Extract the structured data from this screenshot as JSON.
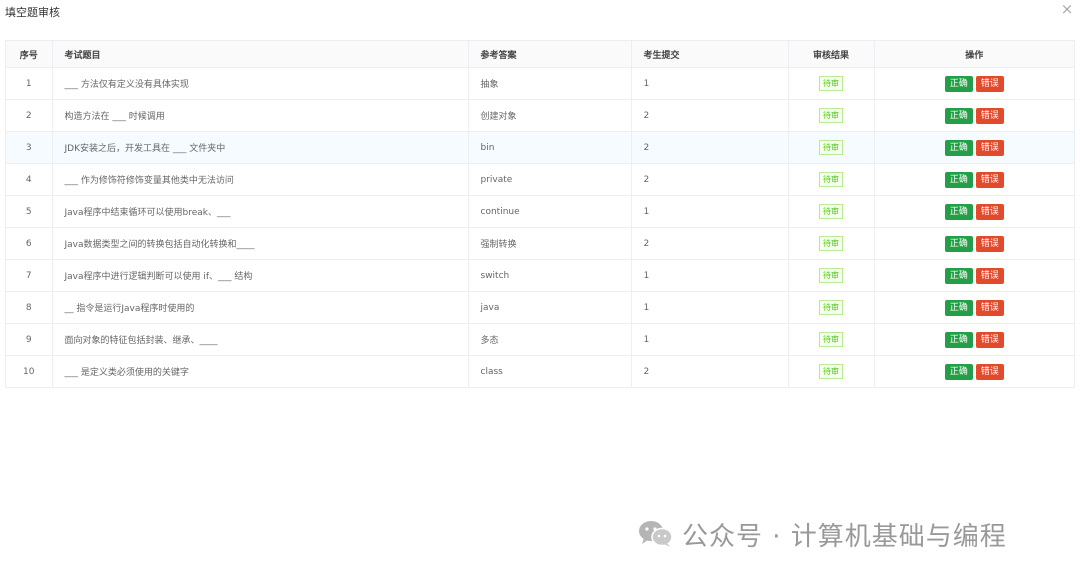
{
  "dialog": {
    "title": "填空题审核",
    "close_icon": "close-icon"
  },
  "table": {
    "headers": {
      "index": "序号",
      "question": "考试题目",
      "reference": "参考答案",
      "submission": "考生提交",
      "result": "审核结果",
      "action": "操作"
    },
    "rows": [
      {
        "index": "1",
        "question": "___ 方法仅有定义没有具体实现",
        "reference": "抽象",
        "submission": "1",
        "status": "待审",
        "correct": "正确",
        "wrong": "错误"
      },
      {
        "index": "2",
        "question": "构造方法在 ___ 时候调用",
        "reference": "创建对象",
        "submission": "2",
        "status": "待审",
        "correct": "正确",
        "wrong": "错误"
      },
      {
        "index": "3",
        "question": "JDK安装之后，开发工具在 ___ 文件夹中",
        "reference": "bin",
        "submission": "2",
        "status": "待审",
        "correct": "正确",
        "wrong": "错误"
      },
      {
        "index": "4",
        "question": "___ 作为修饰符修饰变量其他类中无法访问",
        "reference": "private",
        "submission": "2",
        "status": "待审",
        "correct": "正确",
        "wrong": "错误"
      },
      {
        "index": "5",
        "question": "Java程序中结束循环可以使用break、___",
        "reference": "continue",
        "submission": "1",
        "status": "待审",
        "correct": "正确",
        "wrong": "错误"
      },
      {
        "index": "6",
        "question": "Java数据类型之间的转换包括自动化转换和____",
        "reference": "强制转换",
        "submission": "2",
        "status": "待审",
        "correct": "正确",
        "wrong": "错误"
      },
      {
        "index": "7",
        "question": "Java程序中进行逻辑判断可以使用 if、___ 结构",
        "reference": "switch",
        "submission": "1",
        "status": "待审",
        "correct": "正确",
        "wrong": "错误"
      },
      {
        "index": "8",
        "question": "__ 指令是运行Java程序时使用的",
        "reference": "java",
        "submission": "1",
        "status": "待审",
        "correct": "正确",
        "wrong": "错误"
      },
      {
        "index": "9",
        "question": "面向对象的特征包括封装、继承、____",
        "reference": "多态",
        "submission": "1",
        "status": "待审",
        "correct": "正确",
        "wrong": "错误"
      },
      {
        "index": "10",
        "question": "___ 是定义类必须使用的关键字",
        "reference": "class",
        "submission": "2",
        "status": "待审",
        "correct": "正确",
        "wrong": "错误"
      }
    ]
  },
  "watermark": {
    "text": "公众号 · 计算机基础与编程",
    "icon": "wechat-icon"
  },
  "colors": {
    "correct_button": "#23a047",
    "wrong_button": "#e34a2c",
    "status_green": "#52c41a",
    "highlight_row": "#f5fbff"
  }
}
